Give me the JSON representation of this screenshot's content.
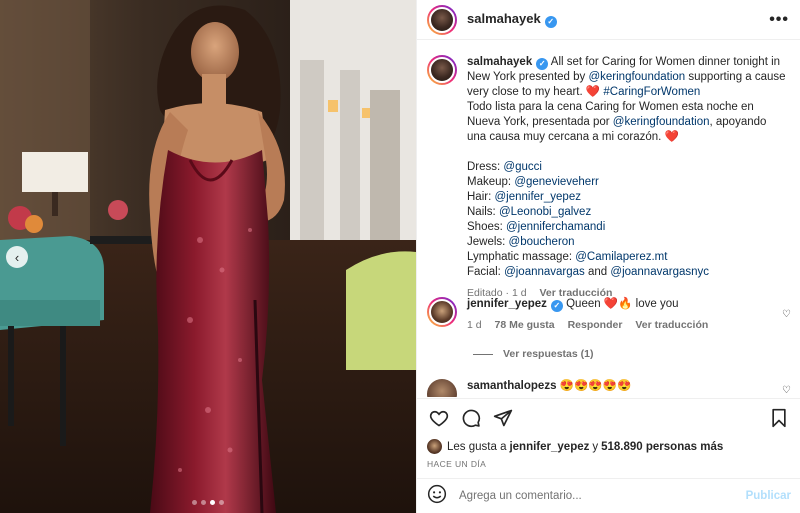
{
  "post": {
    "username": "salmahayek",
    "verified_glyph": "✓",
    "more_glyph": "•••"
  },
  "caption": {
    "username": "salmahayek",
    "line1_pre": "All set for Caring for Women dinner tonight in New York presented by ",
    "line1_mention": "@keringfoundation",
    "line1_post": " supporting a cause very close to my heart. ❤️ ",
    "hashtag": "#CaringForWomen",
    "es_pre": "Todo lista para la cena Caring for Women esta noche en Nueva York, presentada por ",
    "es_mention": "@keringfoundation",
    "es_post": ", apoyando una causa muy cercana a mi corazón. ❤️",
    "credits": [
      {
        "label": "Dress: ",
        "handle": "@gucci",
        "extra_pre": "",
        "extra": ""
      },
      {
        "label": "Makeup: ",
        "handle": "@genevieveherr",
        "extra_pre": "",
        "extra": ""
      },
      {
        "label": "Hair: ",
        "handle": "@jennifer_yepez",
        "extra_pre": "",
        "extra": ""
      },
      {
        "label": "Nails: ",
        "handle": "@Leonobi_galvez",
        "extra_pre": "",
        "extra": ""
      },
      {
        "label": "Shoes: ",
        "handle": "@jenniferchamandi",
        "extra_pre": "",
        "extra": ""
      },
      {
        "label": "Jewels: ",
        "handle": "@boucheron",
        "extra_pre": "",
        "extra": ""
      },
      {
        "label": "Lymphatic massage: ",
        "handle": "@Camilaperez.mt",
        "extra_pre": "",
        "extra": ""
      },
      {
        "label": "Facial: ",
        "handle": "@joannavargas",
        "extra_pre": " and ",
        "extra": "@joannavargasnyc"
      }
    ],
    "edited": "Editado · 1 d",
    "see_translation": "Ver traducción"
  },
  "comments": [
    {
      "username": "jennifer_yepez",
      "text": "Queen ❤️🔥 love you",
      "time": "1 d",
      "likes": "78 Me gusta",
      "reply": "Responder",
      "translate": "Ver traducción",
      "view_replies": "Ver respuestas (1)"
    },
    {
      "username": "samanthalopezs",
      "text": "😍😍😍😍😍"
    }
  ],
  "actions": {
    "likes_prefix": "Les gusta a ",
    "likes_user": "jennifer_yepez",
    "likes_mid": " y ",
    "likes_count": "518.890 personas más",
    "time_ago": "HACE UN DÍA"
  },
  "composer": {
    "placeholder": "Agrega un comentario...",
    "publish": "Publicar"
  },
  "carousel": {
    "prev_glyph": "‹",
    "dots": 4,
    "active_dot": 3
  },
  "colors": {
    "accent_link": "#00376b",
    "verified": "#3897f0",
    "heart": "#ed4956",
    "dress": "#7a1226"
  }
}
